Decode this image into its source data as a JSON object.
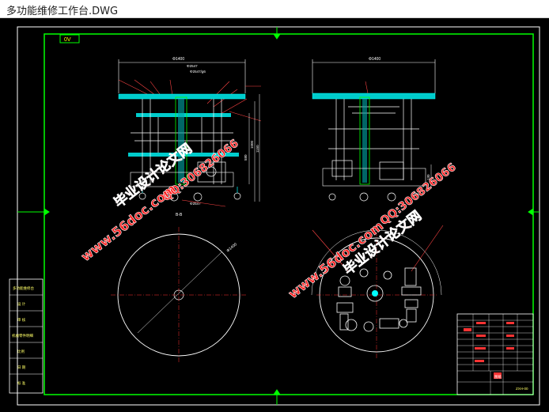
{
  "window": {
    "title": "多功能维修工作台.DWG"
  },
  "drawing": {
    "sheet_tag": "0V",
    "dims": {
      "top_left_width": "Φ1400",
      "top_right_width": "Φ1400",
      "callout_a": "Φ2547",
      "callout_b": "Φ2547/g6",
      "height_total": "1150",
      "height_inner": "1000",
      "height_mid": "580",
      "height_right": "130",
      "section_label": "B-B",
      "bottom_callout": "Φ2547",
      "circle_dia": "Φ1400"
    },
    "legend_rows": [
      "多功能维修台",
      "设 计",
      "审 核",
      "机械零件明细",
      "比例",
      "日 期",
      "标 准"
    ],
    "title_block": {
      "label": "图纸",
      "code": "ZXH-00"
    }
  },
  "watermarks": {
    "site": "www.56doc.com",
    "name": "毕业设计论文网",
    "qq": "QQ:306826066"
  },
  "colors": {
    "background": "#000000",
    "frame": "#00ff00",
    "lines": "#ffffff",
    "leaders": "#ff0000",
    "cyan": "#00ffff",
    "magenta": "#ff00ff",
    "watermark": "#ff0000"
  }
}
